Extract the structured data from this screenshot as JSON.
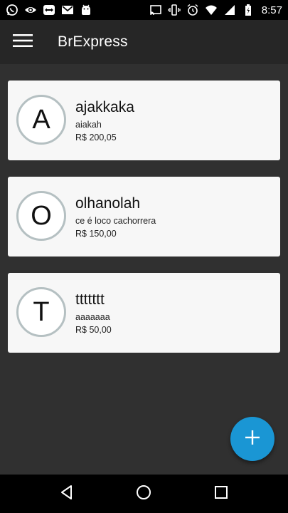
{
  "status_bar": {
    "time": "8:57",
    "left_icons": [
      "whatsapp-icon",
      "eye-icon",
      "teamviewer-icon",
      "gmail-icon",
      "android-icon"
    ],
    "right_icons": [
      "cast-icon",
      "vibrate-icon",
      "alarm-icon",
      "wifi-icon",
      "signal-icon",
      "battery-icon"
    ]
  },
  "app_bar": {
    "title": "BrExpress",
    "menu_icon": "hamburger-menu-icon"
  },
  "items": [
    {
      "initial": "A",
      "name": "ajakkaka",
      "description": "aiakah",
      "price": "R$ 200,05"
    },
    {
      "initial": "O",
      "name": "olhanolah",
      "description": "ce é loco cachorrera",
      "price": "R$ 150,00"
    },
    {
      "initial": "T",
      "name": "ttttttt",
      "description": "aaaaaaa",
      "price": "R$ 50,00"
    }
  ],
  "fab": {
    "icon": "plus-icon",
    "color": "#1a96d4"
  },
  "nav_bar": {
    "icons": [
      "back-icon",
      "home-icon",
      "recents-icon"
    ]
  },
  "colors": {
    "background": "#303030",
    "app_bar": "#262626",
    "card": "#f7f7f7",
    "avatar_border": "#b5c0c2",
    "accent": "#1a96d4"
  }
}
